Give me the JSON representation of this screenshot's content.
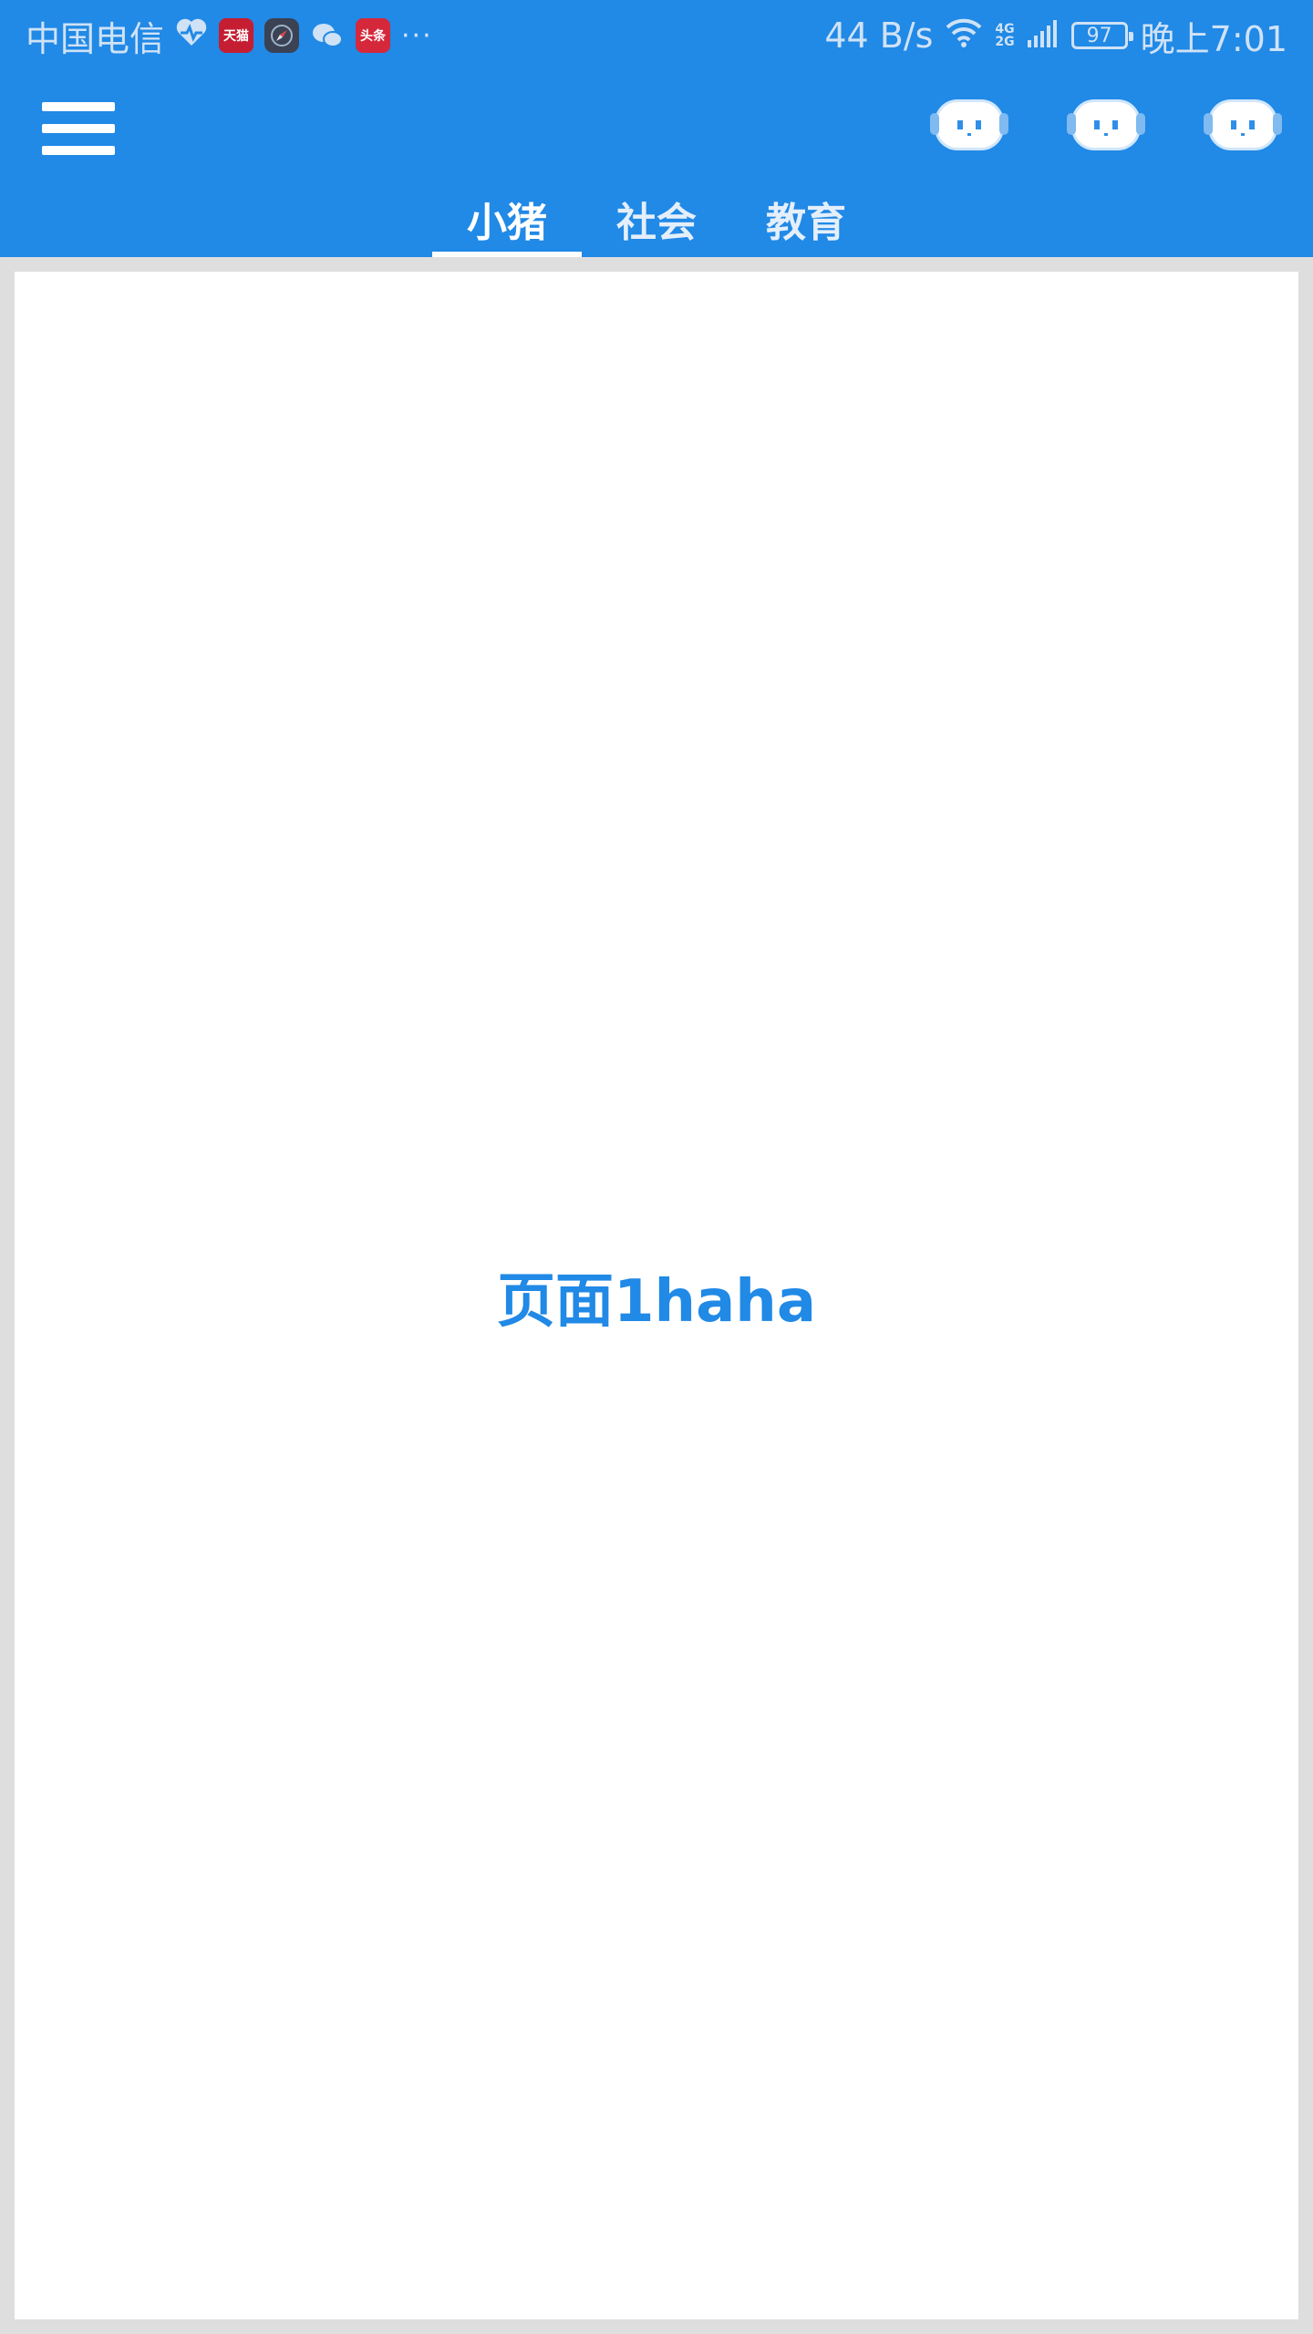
{
  "status_bar": {
    "carrier": "中国电信",
    "notification_icons": [
      "heart-pulse-icon",
      "tmall-app-icon",
      "compass-app-icon",
      "wechat-icon",
      "toutiao-app-icon"
    ],
    "tmall_label": "天猫",
    "toutiao_label": "头条",
    "more": "···",
    "network_speed": "44 B/s",
    "network_4g": "4G",
    "network_2g": "2G",
    "battery_level": "97",
    "time": "晚上7:01"
  },
  "app_bar": {
    "color": "#2189e6",
    "actions": [
      "robot-icon",
      "robot-icon",
      "robot-icon"
    ],
    "tabs": [
      {
        "label": "小猪",
        "active": true
      },
      {
        "label": "社会",
        "active": false
      },
      {
        "label": "教育",
        "active": false
      }
    ]
  },
  "content": {
    "text": "页面1haha",
    "text_color": "#2189e6"
  }
}
